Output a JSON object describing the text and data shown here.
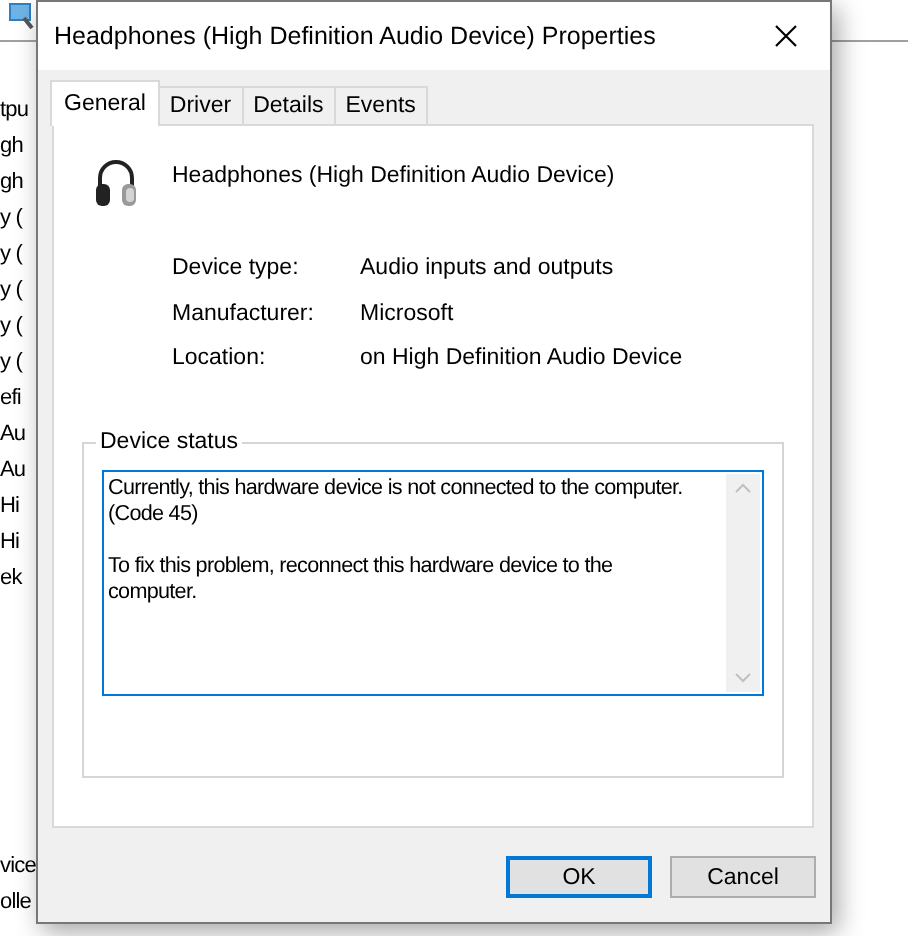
{
  "background_window": {
    "rows_upper": [
      "tpu",
      "gh",
      "gh",
      "y (",
      "y (",
      "y (",
      "y (",
      "y (",
      "efi",
      "Au",
      "Au",
      "Hi",
      "Hi",
      "ek"
    ],
    "rows_lower": [
      "vice",
      "olle"
    ]
  },
  "dialog": {
    "title": "Headphones (High Definition Audio Device) Properties",
    "tabs": [
      {
        "label": "General",
        "selected": true
      },
      {
        "label": "Driver",
        "selected": false
      },
      {
        "label": "Details",
        "selected": false
      },
      {
        "label": "Events",
        "selected": false
      }
    ],
    "device_name": "Headphones (High Definition Audio Device)",
    "properties": [
      {
        "label": "Device type:",
        "value": "Audio inputs and outputs"
      },
      {
        "label": "Manufacturer:",
        "value": "Microsoft"
      },
      {
        "label": "Location:",
        "value": "on High Definition Audio Device"
      }
    ],
    "status_group": {
      "title": "Device status",
      "text": "Currently, this hardware device is not connected to the computer.\n(Code 45)\n\nTo fix this problem, reconnect this hardware device to the\ncomputer."
    },
    "buttons": [
      {
        "label": "OK",
        "default": true
      },
      {
        "label": "Cancel",
        "default": false
      }
    ]
  }
}
